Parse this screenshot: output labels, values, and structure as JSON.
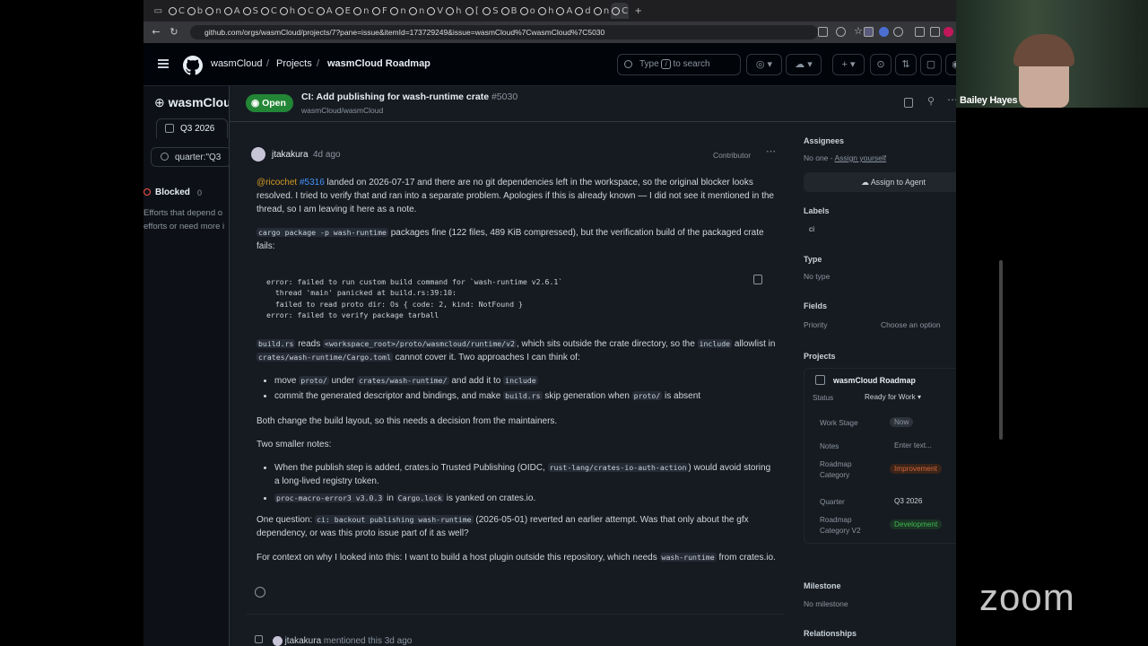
{
  "browser": {
    "tabs": [
      "C",
      "b",
      "n",
      "A",
      "S",
      "C",
      "h",
      "C",
      "A",
      "E",
      "n",
      "F",
      "n",
      "n",
      "V",
      "h",
      "[",
      "S",
      "B",
      "o",
      "h",
      "A",
      "d",
      "n",
      "C"
    ],
    "url": "github.com/orgs/wasmCloud/projects/7?pane=issue&itemId=173729249&issue=wasmCloud%7CwasmCloud%7C5030"
  },
  "header": {
    "org": "wasmCloud",
    "projects": "Projects",
    "project": "wasmCloud Roadmap",
    "search_prefix": "Type",
    "search_key": "/",
    "search_suffix": "to search"
  },
  "background": {
    "org_title": "wasmClou",
    "view_tab": "Q3 2026",
    "filter": "quarter:\"Q3",
    "column_title": "Blocked",
    "column_count": "0",
    "column_desc_1": "Efforts that depend o",
    "column_desc_2": "efforts or need more i"
  },
  "issue": {
    "state": "Open",
    "title": "CI: Add publishing for wash-runtime crate",
    "number": "#5030",
    "repo": "wasmCloud/wasmCloud"
  },
  "comment": {
    "author": "jtakakura",
    "time": "4d ago",
    "role": "Contributor",
    "p1_mention": "@ricochet",
    "p1_link": "#5316",
    "p1_text": "landed on 2026-07-17 and there are no git dependencies left in the workspace, so the original blocker looks resolved. I tried to verify that and ran into a separate problem. Apologies if this is already known — I did not see it mentioned in the thread, so I am leaving it here as a note.",
    "p2_code": "cargo package -p wash-runtime",
    "p2_text": "packages fine (122 files, 489 KiB compressed), but the verification build of the packaged crate fails:",
    "codeblock": "error: failed to run custom build command for `wash-runtime v2.6.1`\n  thread 'main' panicked at build.rs:39:10:\n  failed to read proto dir: Os { code: 2, kind: NotFound }\nerror: failed to verify package tarball",
    "p3_code1": "build.rs",
    "p3_t1": "reads",
    "p3_code2": "<workspace_root>/proto/wasmcloud/runtime/v2",
    "p3_t2": ", which sits outside the crate directory, so the",
    "p3_code3": "include",
    "p3_t3": "allowlist in",
    "p3_code4": "crates/wash-runtime/Cargo.toml",
    "p3_t4": "cannot cover it. Two approaches I can think of:",
    "b1_t1": "move",
    "b1_c1": "proto/",
    "b1_t2": "under",
    "b1_c2": "crates/wash-runtime/",
    "b1_t3": "and add it to",
    "b1_c3": "include",
    "b2_t1": "commit the generated descriptor and bindings, and make",
    "b2_c1": "build.rs",
    "b2_t2": "skip generation when",
    "b2_c2": "proto/",
    "b2_t3": "is absent",
    "p4": "Both change the build layout, so this needs a decision from the maintainers.",
    "p5": "Two smaller notes:",
    "n1_t1": "When the publish step is added, crates.io Trusted Publishing (OIDC,",
    "n1_c1": "rust-lang/crates-io-auth-action",
    "n1_t2": ") would avoid storing a long-lived registry token.",
    "n2_c1": "proc-macro-error3 v3.0.3",
    "n2_t1": "in",
    "n2_c2": "Cargo.lock",
    "n2_t2": "is yanked on crates.io.",
    "q_t1": "One question:",
    "q_c1": "ci: backout publishing wash-runtime",
    "q_t2": "(2026-05-01) reverted an earlier attempt. Was that only about the gfx dependency, or was this proto issue part of it as well?",
    "c_t1": "For context on why I looked into this: I want to build a host plugin outside this repository, which needs",
    "c_c1": "wash-runtime",
    "c_t2": "from crates.io."
  },
  "timeline": {
    "author": "jtakakura",
    "text": "mentioned this 3d ago"
  },
  "sidebar": {
    "assignees_label": "Assignees",
    "assignees_value": "No one -",
    "assign_yourself": "Assign yourself",
    "assign_agent": "Assign to Agent",
    "labels_label": "Labels",
    "label_ci": "ci",
    "type_label": "Type",
    "type_value": "No type",
    "fields_label": "Fields",
    "priority_label": "Priority",
    "priority_value": "Choose an option",
    "projects_label": "Projects",
    "project_name": "wasmCloud Roadmap",
    "status_label": "Status",
    "status_value": "Ready for Work",
    "work_stage_label": "Work Stage",
    "work_stage_value": "Now",
    "notes_label": "Notes",
    "notes_placeholder": "Enter text...",
    "roadmap_cat_label_1": "Roadmap",
    "roadmap_cat_label_2": "Category",
    "roadmap_cat_value": "Improvement",
    "quarter_label": "Quarter",
    "quarter_value": "Q3 2026",
    "roadmap_cat2_label_1": "Roadmap",
    "roadmap_cat2_label_2": "Category V2",
    "roadmap_cat2_value": "Development",
    "milestone_label": "Milestone",
    "milestone_value": "No milestone",
    "relationships_label": "Relationships"
  },
  "zoom": {
    "participant": "Bailey Hayes",
    "logo": "zoom"
  },
  "colors": {
    "open_green": "#238636",
    "link_blue": "#4493f8",
    "mention_yellow": "#d29922",
    "improvement": "#d1673a",
    "development": "#3fb950"
  }
}
